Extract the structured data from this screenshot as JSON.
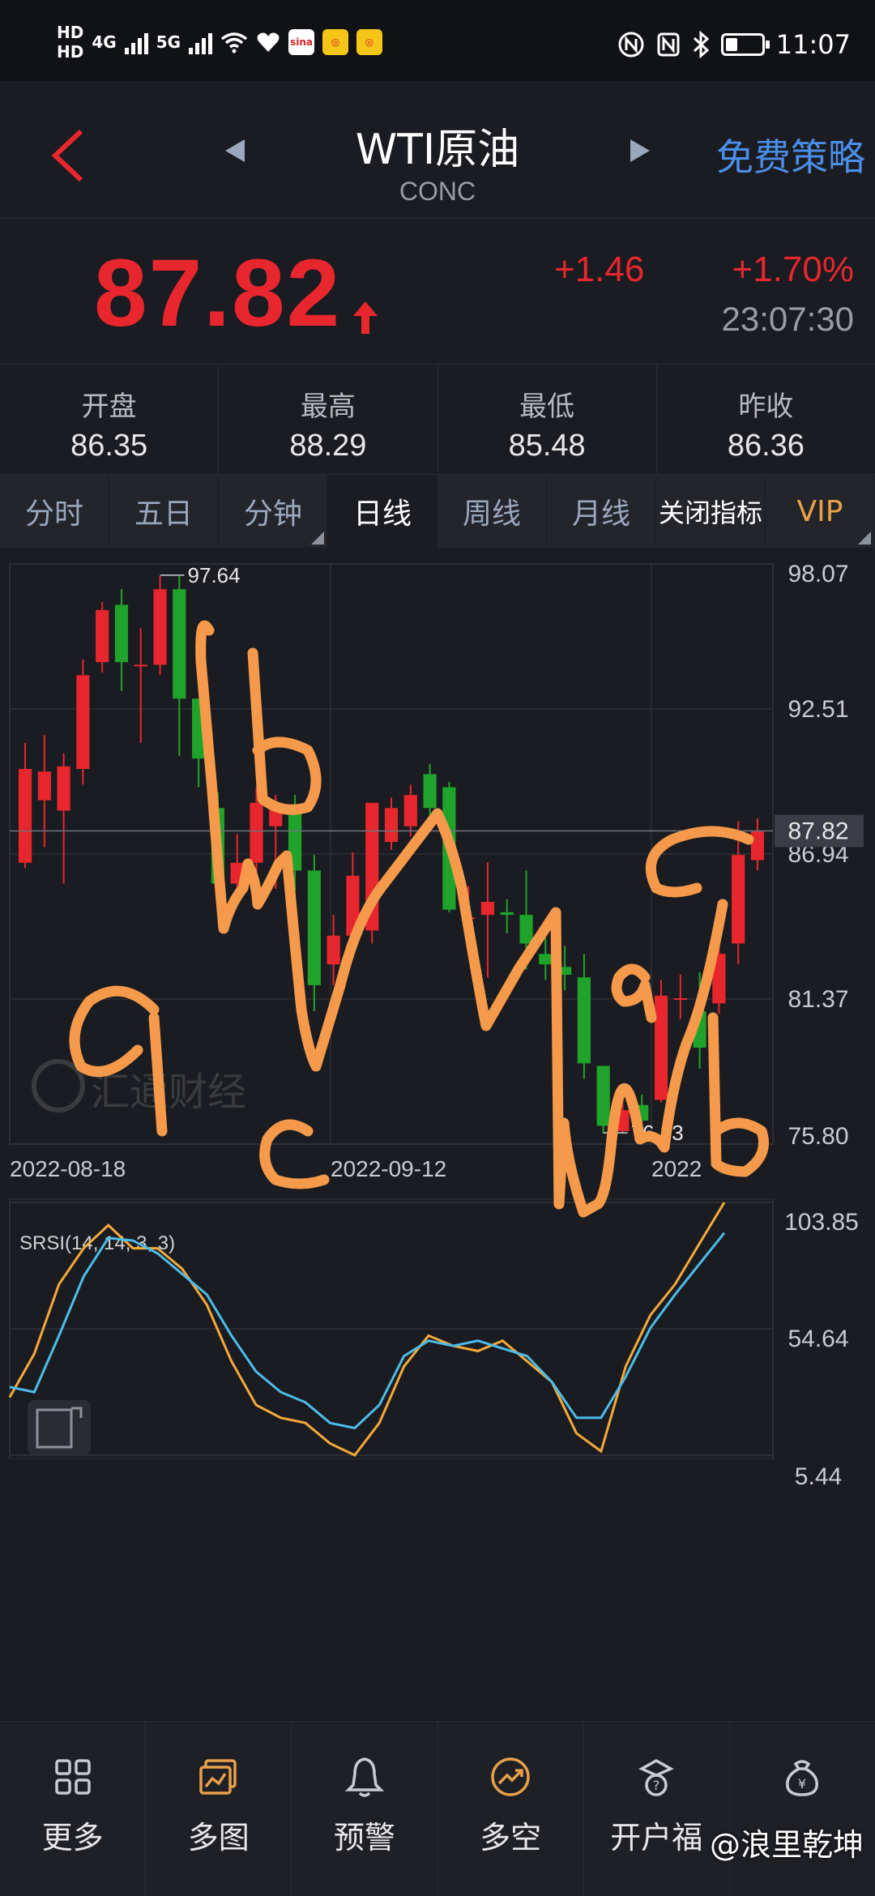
{
  "status_bar": {
    "hd1": "HD",
    "hd2": "HD",
    "net1": "4G",
    "net2": "5G",
    "time": "11:07"
  },
  "header": {
    "title": "WTI原油",
    "subtitle": "CONC",
    "free_strategy": "免费策略"
  },
  "quote": {
    "price": "87.82",
    "change": "+1.46",
    "change_pct": "+1.70%",
    "time": "23:07:30",
    "color_up": "#e8262d"
  },
  "stats": [
    {
      "label": "开盘",
      "value": "86.35"
    },
    {
      "label": "最高",
      "value": "88.29"
    },
    {
      "label": "最低",
      "value": "85.48"
    },
    {
      "label": "昨收",
      "value": "86.36"
    }
  ],
  "tabs": [
    {
      "label": "分时",
      "active": false
    },
    {
      "label": "五日",
      "active": false
    },
    {
      "label": "分钟",
      "active": false
    },
    {
      "label": "日线",
      "active": true
    },
    {
      "label": "周线",
      "active": false
    },
    {
      "label": "月线",
      "active": false
    },
    {
      "label": "关闭指标",
      "active": false
    },
    {
      "label": "VIP",
      "active": false
    }
  ],
  "chart_data": {
    "type": "candlestick",
    "price_axis": [
      "98.07",
      "92.51",
      "86.94",
      "81.37",
      "75.80"
    ],
    "ylim": [
      75.8,
      98.07
    ],
    "current_price_label": "87.82",
    "current_price": 87.82,
    "high_marker": "97.64",
    "high_value": 97.64,
    "low_marker": "76.23",
    "low_value": 76.23,
    "date_labels": [
      "2022-08-18",
      "2022-09-12",
      "2022"
    ],
    "watermark": "汇通财经",
    "candles": [
      {
        "o": 86.6,
        "c": 90.2,
        "h": 91.2,
        "l": 86.4
      },
      {
        "o": 89.0,
        "c": 90.1,
        "h": 91.5,
        "l": 87.2
      },
      {
        "o": 88.6,
        "c": 90.3,
        "h": 90.8,
        "l": 85.8
      },
      {
        "o": 90.2,
        "c": 93.8,
        "h": 94.4,
        "l": 89.6
      },
      {
        "o": 94.3,
        "c": 96.3,
        "h": 96.6,
        "l": 93.9
      },
      {
        "o": 96.5,
        "c": 94.3,
        "h": 97.1,
        "l": 93.2
      },
      {
        "o": 94.2,
        "c": 94.2,
        "h": 95.6,
        "l": 91.2
      },
      {
        "o": 94.2,
        "c": 97.1,
        "h": 97.6,
        "l": 93.8
      },
      {
        "o": 97.1,
        "c": 92.9,
        "h": 97.6,
        "l": 90.7
      },
      {
        "o": 92.9,
        "c": 90.6,
        "h": 92.7,
        "l": 89.5
      },
      {
        "o": 88.7,
        "c": 85.8,
        "h": 89.3,
        "l": 85.1
      },
      {
        "o": 85.8,
        "c": 86.6,
        "h": 87.7,
        "l": 85.3
      },
      {
        "o": 86.6,
        "c": 88.9,
        "h": 89.5,
        "l": 86.2
      },
      {
        "o": 88.0,
        "c": 88.8,
        "h": 89.2,
        "l": 85.6
      },
      {
        "o": 88.7,
        "c": 86.3,
        "h": 89.2,
        "l": 85.5
      },
      {
        "o": 86.3,
        "c": 81.9,
        "h": 86.9,
        "l": 80.9
      },
      {
        "o": 82.7,
        "c": 83.8,
        "h": 84.6,
        "l": 81.9
      },
      {
        "o": 83.8,
        "c": 86.1,
        "h": 87.0,
        "l": 83.1
      },
      {
        "o": 84.0,
        "c": 88.9,
        "h": 88.5,
        "l": 83.5
      },
      {
        "o": 87.4,
        "c": 88.7,
        "h": 89.1,
        "l": 87.1
      },
      {
        "o": 88.0,
        "c": 89.2,
        "h": 89.6,
        "l": 87.6
      },
      {
        "o": 90.0,
        "c": 88.7,
        "h": 90.4,
        "l": 88.2
      },
      {
        "o": 89.5,
        "c": 84.8,
        "h": 89.7,
        "l": 84.7
      },
      {
        "o": 84.5,
        "c": 84.5,
        "h": 85.7,
        "l": 84.1
      },
      {
        "o": 84.6,
        "c": 85.1,
        "h": 86.6,
        "l": 82.2
      },
      {
        "o": 84.7,
        "c": 84.6,
        "h": 85.2,
        "l": 83.9
      },
      {
        "o": 84.6,
        "c": 83.5,
        "h": 86.3,
        "l": 82.5
      },
      {
        "o": 83.1,
        "c": 82.7,
        "h": 83.7,
        "l": 82.1
      },
      {
        "o": 82.6,
        "c": 82.3,
        "h": 83.4,
        "l": 81.7
      },
      {
        "o": 82.2,
        "c": 78.9,
        "h": 83.1,
        "l": 78.3
      },
      {
        "o": 78.8,
        "c": 76.5,
        "h": 78.2,
        "l": 76.2
      },
      {
        "o": 76.3,
        "c": 77.1,
        "h": 78.1,
        "l": 76.2
      },
      {
        "o": 77.3,
        "c": 76.7,
        "h": 77.7,
        "l": 76.4
      },
      {
        "o": 77.5,
        "c": 81.5,
        "h": 82.1,
        "l": 77.4
      },
      {
        "o": 81.4,
        "c": 81.4,
        "h": 82.3,
        "l": 80.6
      },
      {
        "o": 80.9,
        "c": 79.5,
        "h": 82.4,
        "l": 78.7
      },
      {
        "o": 81.2,
        "c": 83.1,
        "h": 83.9,
        "l": 80.8
      },
      {
        "o": 83.5,
        "c": 86.9,
        "h": 88.2,
        "l": 82.7
      },
      {
        "o": 86.7,
        "c": 87.8,
        "h": 88.3,
        "l": 86.3
      }
    ],
    "up_color": "#e8262d",
    "down_color": "#1fa32a",
    "indicator": {
      "label": "SRSI(14, 14, 3, 3)",
      "axis": [
        "103.85",
        "54.64",
        "5.44"
      ],
      "ylim": [
        5.44,
        103.85
      ],
      "series": [
        {
          "name": "",
          "color": "#f5a93a",
          "values": [
            28,
            45,
            72,
            86,
            95,
            86,
            86,
            78,
            64,
            42,
            25,
            20,
            18,
            10,
            3,
            18,
            40,
            52,
            48,
            46,
            50,
            42,
            34,
            14,
            7,
            40,
            60,
            72,
            88,
            104
          ]
        },
        {
          "name": "",
          "color": "#4bbcea",
          "values": [
            32,
            30,
            52,
            75,
            90,
            89,
            84,
            76,
            68,
            52,
            38,
            30,
            26,
            18,
            16,
            25,
            44,
            50,
            48,
            50,
            47,
            44,
            34,
            20,
            20,
            36,
            55,
            68,
            80,
            92
          ]
        }
      ]
    },
    "annotations": [
      "b",
      "a",
      "c",
      "a",
      "c",
      "b"
    ]
  },
  "bottom_nav": [
    {
      "label": "更多",
      "icon": "grid-icon"
    },
    {
      "label": "多图",
      "icon": "multi-chart-icon"
    },
    {
      "label": "预警",
      "icon": "bell-icon"
    },
    {
      "label": "多空",
      "icon": "trend-icon"
    },
    {
      "label": "开户福",
      "icon": "gift-icon"
    },
    {
      "label": "",
      "icon": "piggy-icon"
    }
  ],
  "bottom_watermark": "@浪里乾坤"
}
